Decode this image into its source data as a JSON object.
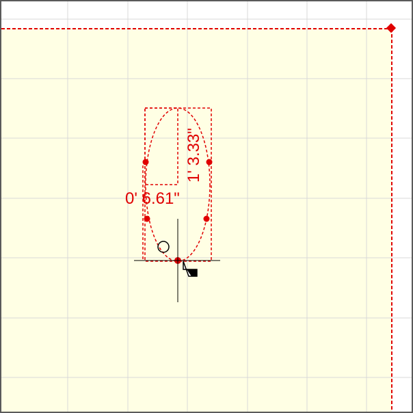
{
  "canvas": {
    "background_color": "#ffffff",
    "sheet_color": "#ffffe4",
    "grid_color": "#d8d8d8",
    "sheet_edge_color": "#e00000",
    "selection_color": "#e00000",
    "cursor_color": "#000000"
  },
  "shape": {
    "type": "ellipse",
    "selected": true
  },
  "dimensions": {
    "width_label": "0' 6.61\"",
    "height_label": "1' 3.33\""
  },
  "cursor": {
    "type": "crosshair",
    "badge_icon": "corner-flag-icon",
    "snap_indicator": "circle-icon"
  }
}
